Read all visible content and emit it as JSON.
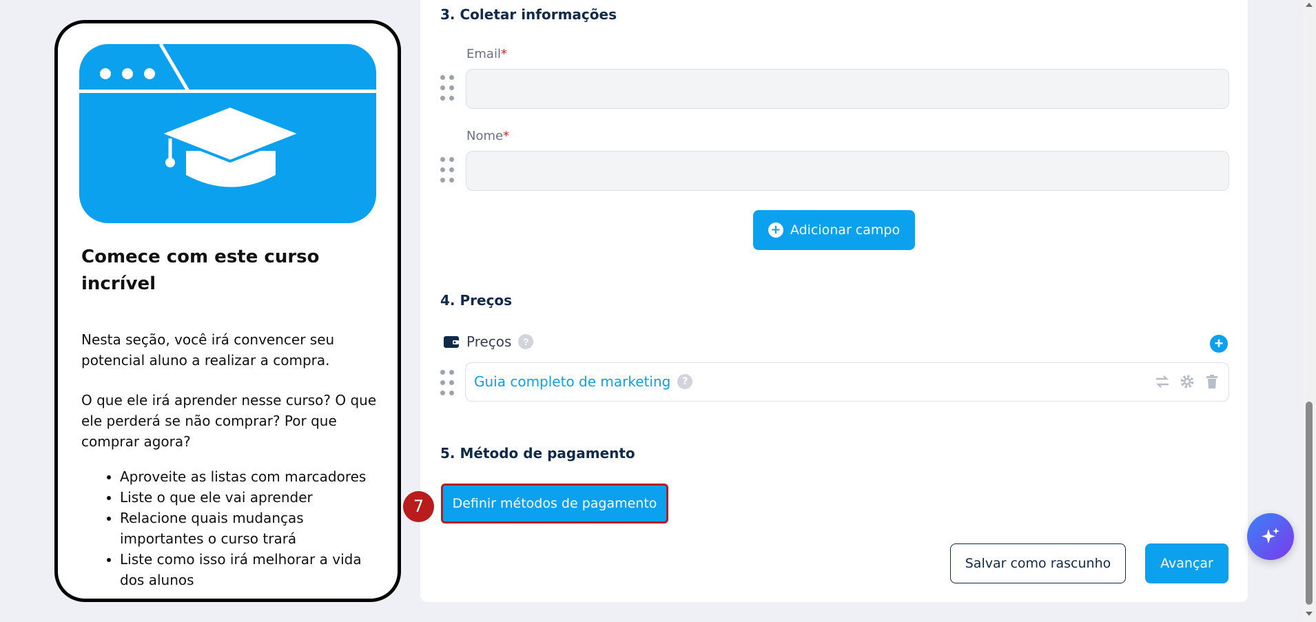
{
  "preview": {
    "title": "Comece com este curso incrível",
    "paragraph1": "Nesta seção, você irá convencer seu potencial aluno a realizar a compra.",
    "paragraph2": "O que ele irá aprender nesse curso? O que ele perderá se não comprar? Por que comprar agora?",
    "bullets": [
      "Aproveite as listas com marcadores",
      "Liste o que ele vai aprender",
      "Relacione quais mudanças importantes o curso trará",
      "Liste como isso irá melhorar a vida dos alunos"
    ],
    "banner_icon": "graduation-cap-browser-icon",
    "accent": "#0ba1ee"
  },
  "section3": {
    "title": "3. Coletar informações",
    "fields": [
      {
        "label": "Email",
        "required_mark": "*",
        "value": ""
      },
      {
        "label": "Nome",
        "required_mark": "*",
        "value": ""
      }
    ],
    "add_field_label": "Adicionar campo"
  },
  "section4": {
    "title": "4. Preços",
    "header_label": "Preços",
    "help_glyph": "?",
    "items": [
      {
        "name": "Guia completo de marketing"
      }
    ]
  },
  "section5": {
    "title": "5. Método de pagamento",
    "button_label": "Definir métodos de pagamento",
    "step_badge": "7"
  },
  "footer": {
    "draft_label": "Salvar como rascunho",
    "next_label": "Avançar"
  },
  "colors": {
    "primary": "#0ba1ee",
    "heading": "#0f2a4a",
    "highlight": "#b91c1c"
  }
}
